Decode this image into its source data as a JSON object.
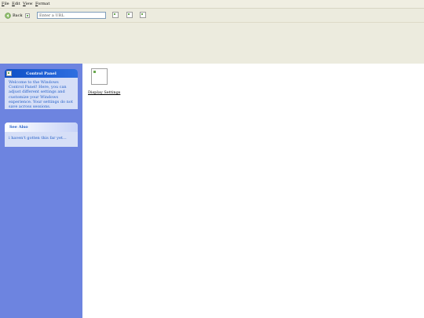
{
  "menubar": {
    "items": [
      {
        "accel": "F",
        "rest": "ile"
      },
      {
        "accel": "E",
        "rest": "dit"
      },
      {
        "accel": "V",
        "rest": "iew"
      },
      {
        "accel": "F",
        "rest": "ormat"
      }
    ]
  },
  "toolbar": {
    "back_label": "Back",
    "url_placeholder": "Enter a URL",
    "url_value": ""
  },
  "sidebar": {
    "control_panel": {
      "title": "Control Panel",
      "text": "Welcome to the Windows Control Panel! Here, you can adjust different settings and customize your Windows experience. Your settings do not save across sessions."
    },
    "see_also": {
      "title": "See Also",
      "text": "i haven't gotten this far yet..."
    }
  },
  "main": {
    "applets": [
      {
        "label": "Display Settings",
        "icon": "display-settings-icon"
      }
    ]
  },
  "colors": {
    "chrome": "#ecebde",
    "sidebar": "#6d84e0",
    "panel_header": "#0e4fc6",
    "panel_body": "#d6dff7",
    "panel_text": "#215dc6"
  }
}
